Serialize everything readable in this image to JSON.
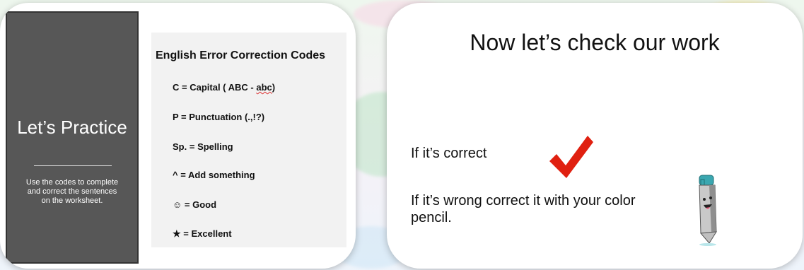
{
  "left_slide": {
    "title": "Let’s Practice",
    "description": "Use the codes to complete and correct the sentences on the worksheet.",
    "codes_title": "English Error Correction Codes",
    "codes": [
      {
        "code": "C =",
        "meaning_pre": "Capital ( ABC - ",
        "meaning_mark": "abc",
        "meaning_post": ")"
      },
      {
        "code": "P =",
        "meaning_pre": "Punctuation (.,!?)",
        "meaning_mark": "",
        "meaning_post": ""
      },
      {
        "code": "Sp. =",
        "meaning_pre": "Spelling",
        "meaning_mark": "",
        "meaning_post": ""
      },
      {
        "code": "^  =",
        "meaning_pre": "Add something",
        "meaning_mark": "",
        "meaning_post": ""
      },
      {
        "code": "☺ =",
        "meaning_pre": "Good",
        "meaning_mark": "",
        "meaning_post": ""
      },
      {
        "code": "★ =",
        "meaning_pre": "Excellent",
        "meaning_mark": "",
        "meaning_post": ""
      }
    ]
  },
  "right_slide": {
    "heading": "Now let’s check our work",
    "correct_text": "If it’s correct",
    "wrong_text": "If it’s wrong correct it with your color pencil.",
    "check_color": "#e02010",
    "pencil_color": "#3aa7b0"
  }
}
